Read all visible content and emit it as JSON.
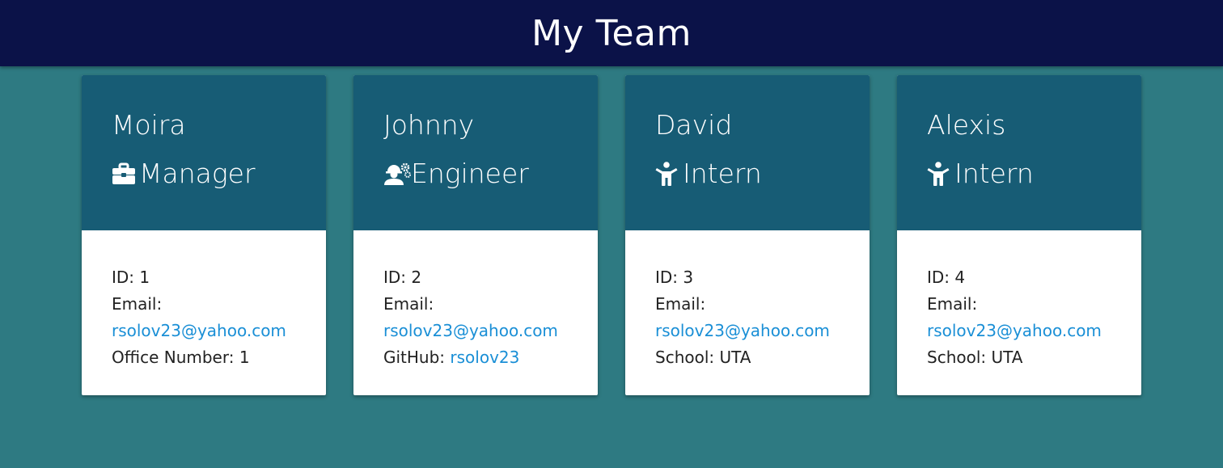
{
  "header": {
    "title": "My Team"
  },
  "colors": {
    "header_bg": "#0b1248",
    "page_bg": "#2e7a82",
    "card_top_bg": "#175c75",
    "link": "#1a8fd6"
  },
  "cards": [
    {
      "name": "Moira",
      "role": "Manager",
      "icon": "briefcase-icon",
      "id_text": "ID: 1",
      "email_label": "Email:",
      "email": "rsolov23@yahoo.com",
      "extra_label": "Office Number: 1",
      "extra_link": ""
    },
    {
      "name": "Johnny",
      "role": "Engineer",
      "icon": "user-gears-icon",
      "id_text": "ID: 2",
      "email_label": "Email:",
      "email": "rsolov23@yahoo.com",
      "extra_label": "GitHub: ",
      "extra_link": "rsolov23"
    },
    {
      "name": "David",
      "role": "Intern",
      "icon": "child-icon",
      "id_text": "ID: 3",
      "email_label": "Email:",
      "email": "rsolov23@yahoo.com",
      "extra_label": "School: UTA",
      "extra_link": ""
    },
    {
      "name": "Alexis",
      "role": "Intern",
      "icon": "child-icon",
      "id_text": "ID: 4",
      "email_label": "Email:",
      "email": "rsolov23@yahoo.com",
      "extra_label": "School: UTA",
      "extra_link": ""
    }
  ]
}
